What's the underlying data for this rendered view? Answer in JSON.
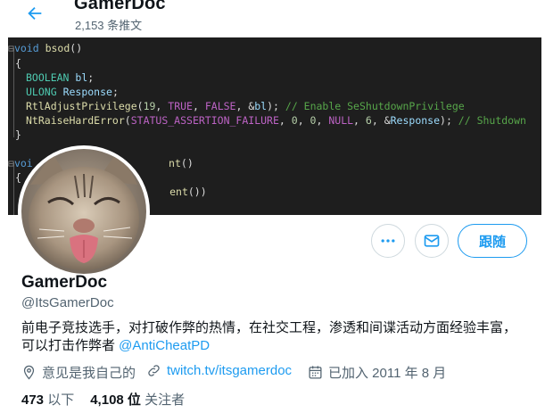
{
  "header": {
    "name": "GamerDoc",
    "tweet_count": "2,153 条推文"
  },
  "banner": {
    "lines": [
      "void bsod()",
      "{",
      "BOOLEAN bl;",
      "ULONG Response;",
      "RtlAdjustPrivilege(19, TRUE, FALSE, &bl);",
      "// Enable SeShutdownPrivilege",
      "NtRaiseHardError(STATUS_ASSERTION_FAILURE, 0, 0, NULL, 6, &Response);",
      "// Shutdown",
      "}",
      "voi",
      "nt()",
      "{",
      "ent())"
    ]
  },
  "actions": {
    "follow_label": "跟随"
  },
  "profile": {
    "name": "GamerDoc",
    "handle": "@ItsGamerDoc",
    "bio_line1": "前电子竞技选手，对打破作弊的热情，在社交工程，渗透和间谍活动方面经验丰富，",
    "bio_line2": "可以打击作弊者 ",
    "bio_mention": "@AntiCheatPD",
    "location": "意见是我自己的",
    "website": "twitch.tv/itsgamerdoc",
    "joined": "已加入 2011 年 8 月"
  },
  "stats": {
    "following_count": "473",
    "following_label": "以下",
    "followers_count": "4,108 位",
    "followers_label": "关注者"
  },
  "colors": {
    "accent": "#1d9bf0",
    "banner_bg": "#1e1e1e"
  },
  "icons": [
    "back-arrow-icon",
    "more-icon",
    "mail-icon",
    "location-icon",
    "link-icon",
    "calendar-icon"
  ]
}
